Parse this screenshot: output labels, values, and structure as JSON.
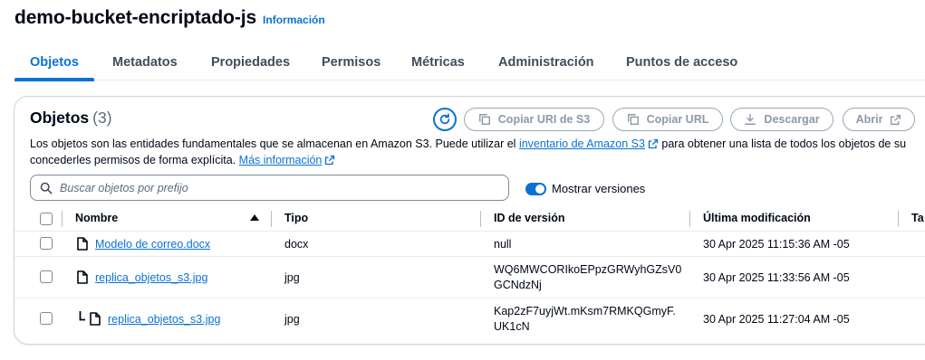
{
  "header": {
    "bucket_name": "demo-bucket-encriptado-js",
    "info_link": "Información"
  },
  "tabs": [
    {
      "label": "Objetos",
      "active": true
    },
    {
      "label": "Metadatos",
      "active": false
    },
    {
      "label": "Propiedades",
      "active": false
    },
    {
      "label": "Permisos",
      "active": false
    },
    {
      "label": "Métricas",
      "active": false
    },
    {
      "label": "Administración",
      "active": false
    },
    {
      "label": "Puntos de acceso",
      "active": false
    }
  ],
  "objects_panel": {
    "title": "Objetos",
    "count": "(3)",
    "buttons": {
      "copy_uri": "Copiar URI de S3",
      "copy_url": "Copiar URL",
      "download": "Descargar",
      "open": "Abrir"
    },
    "description": {
      "part1": "Los objetos son las entidades fundamentales que se almacenan en Amazon S3. Puede utilizar el ",
      "inventory_link": "inventario de Amazon S3",
      "part2": " para obtener una lista de todos los objetos de su",
      "line2": "concederles permisos de forma explícita. ",
      "more_info_link": "Más información"
    },
    "search": {
      "placeholder": "Buscar objetos por prefijo",
      "value": ""
    },
    "show_versions": {
      "label": "Mostrar versiones",
      "enabled": true
    },
    "table": {
      "columns": [
        "Nombre",
        "Tipo",
        "ID de versión",
        "Última modificación",
        "Ta"
      ],
      "sort_column": "Nombre",
      "sort_direction": "ascending",
      "rows": [
        {
          "name": "Modelo de correo.docx",
          "type": "docx",
          "version_id": "null",
          "modified": "30 Apr 2025 11:15:36 AM -05",
          "is_version": false
        },
        {
          "name": "replica_objetos_s3.jpg",
          "type": "jpg",
          "version_id": "WQ6MWCORIkoEPpzGRWyhGZsV0GCNdzNj",
          "version_line1": "WQ6MWCORIkoEPpzGRWyhGZsV0",
          "version_line2": "GCNdzNj",
          "modified": "30 Apr 2025 11:33:56 AM -05",
          "is_version": false
        },
        {
          "name": "replica_objetos_s3.jpg",
          "type": "jpg",
          "version_id": "Kap2zF7uyjWt.mKsm7RMKQGmyF.UK1cN",
          "version_line1": "Kap2zF7uyjWt.mKsm7RMKQGmyF.",
          "version_line2": "UK1cN",
          "modified": "30 Apr 2025 11:27:04 AM -05",
          "is_version": true
        }
      ]
    }
  },
  "colors": {
    "accent": "#0972d3",
    "text": "#000716",
    "muted_button": "#8d99a8",
    "border": "#d1d5db"
  }
}
